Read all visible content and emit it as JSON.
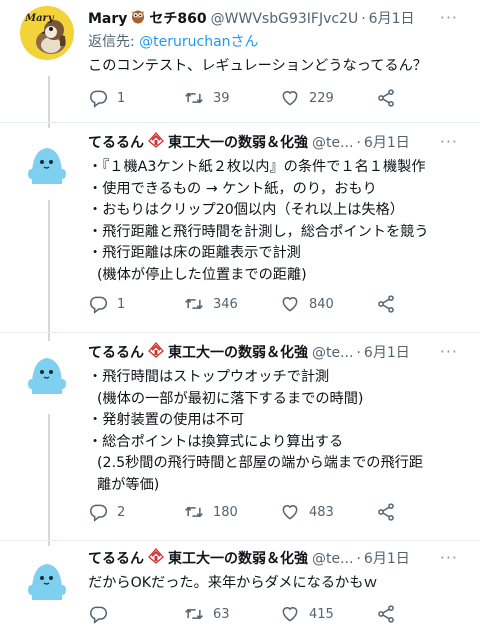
{
  "tweets": [
    {
      "name": "Mary",
      "badge": "owl-emoji",
      "name_suffix": "セチ860",
      "handle": "@WWVsbG93IFJvc2U",
      "date": "6月1日",
      "reply_label": "返信先:",
      "reply_mention": "@teruruchanさん",
      "lines": [
        "このコンテスト、レギュレーションどうなってるん？"
      ],
      "counts": {
        "reply": "1",
        "retweet": "39",
        "like": "229"
      }
    },
    {
      "name": "てるるん",
      "badge": "tech-logo",
      "name_suffix": "東工大一の数弱＆化強",
      "handle": "@te...",
      "date": "6月1日",
      "lines": [
        "・『１機A3ケント紙２枚以内』の条件で１名１機製作",
        "・使用できるもの → ケント紙，のり，おもり",
        "・おもりはクリップ20個以内（それ以上は失格）",
        "・飛行距離と飛行時間を計測し，総合ポイントを競う",
        "・飛行距離は床の距離表示で計測",
        "  (機体が停止した位置までの距離)"
      ],
      "counts": {
        "reply": "1",
        "retweet": "346",
        "like": "840"
      }
    },
    {
      "name": "てるるん",
      "badge": "tech-logo",
      "name_suffix": "東工大一の数弱＆化強",
      "handle": "@te...",
      "date": "6月1日",
      "lines": [
        "・飛行時間はストップウオッチで計測",
        "  (機体の一部が最初に落下するまでの時間)",
        "・発射装置の使用は不可",
        "・総合ポイントは換算式により算出する",
        "  (2.5秒間の飛行時間と部屋の端から端までの飛行距",
        "  離が等価)"
      ],
      "counts": {
        "reply": "2",
        "retweet": "180",
        "like": "483"
      }
    },
    {
      "name": "てるるん",
      "badge": "tech-logo",
      "name_suffix": "東工大一の数弱＆化強",
      "handle": "@te...",
      "date": "6月1日",
      "lines": [
        "だからOKだった。来年からダメになるかもｗ"
      ],
      "counts": {
        "reply": "",
        "retweet": "63",
        "like": "415"
      }
    }
  ],
  "ui": {
    "more": "···",
    "avatar_text": "Mary"
  },
  "colors": {
    "accent": "#1d9bf0",
    "secondary": "#536471",
    "divider": "#e6ecf0",
    "avatar_blue": "#7fd0f0"
  }
}
